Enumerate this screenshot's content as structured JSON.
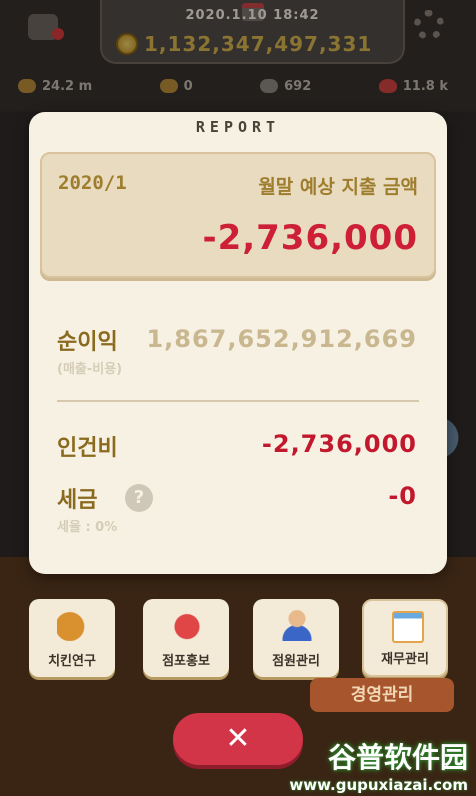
{
  "hud": {
    "datetime": "2020.1.10 18:42",
    "money": "1,132,347,497,331",
    "stats": [
      "24.2 m",
      "0",
      "692",
      "11.8 k"
    ],
    "icons": [
      "hud-left-icon",
      "calendar-icon",
      "coin-icon",
      "gear-icon"
    ]
  },
  "report": {
    "title": "REPORT",
    "forecast": {
      "date": "2020/1",
      "label": "월말 예상 지출 금액",
      "value": "-2,736,000"
    },
    "net_profit": {
      "label": "순이익",
      "sub": "(매출-비용)",
      "value": "1,867,652,912,669"
    },
    "labor": {
      "label": "인건비",
      "value": "-2,736,000"
    },
    "tax": {
      "label": "세금",
      "help": "?",
      "sub": "세율 : 0%",
      "value": "-0"
    }
  },
  "menu": [
    {
      "label": "치킨연구",
      "icon": "chicken-icon"
    },
    {
      "label": "점포홍보",
      "icon": "promo-icon"
    },
    {
      "label": "점원관리",
      "icon": "staff-icon"
    },
    {
      "label": "재무관리",
      "icon": "finance-icon"
    }
  ],
  "behind_label": "경영관리",
  "close": {
    "label": "✕"
  },
  "watermark": {
    "main": "谷普软件园",
    "url": "www.gupuxiazai.com"
  },
  "colors": {
    "panel": "#f7f1e3",
    "forecast_box": "#e9dbbf",
    "negative": "#c2182e",
    "gold": "#9e7d2e",
    "close_button": "#d23448"
  }
}
